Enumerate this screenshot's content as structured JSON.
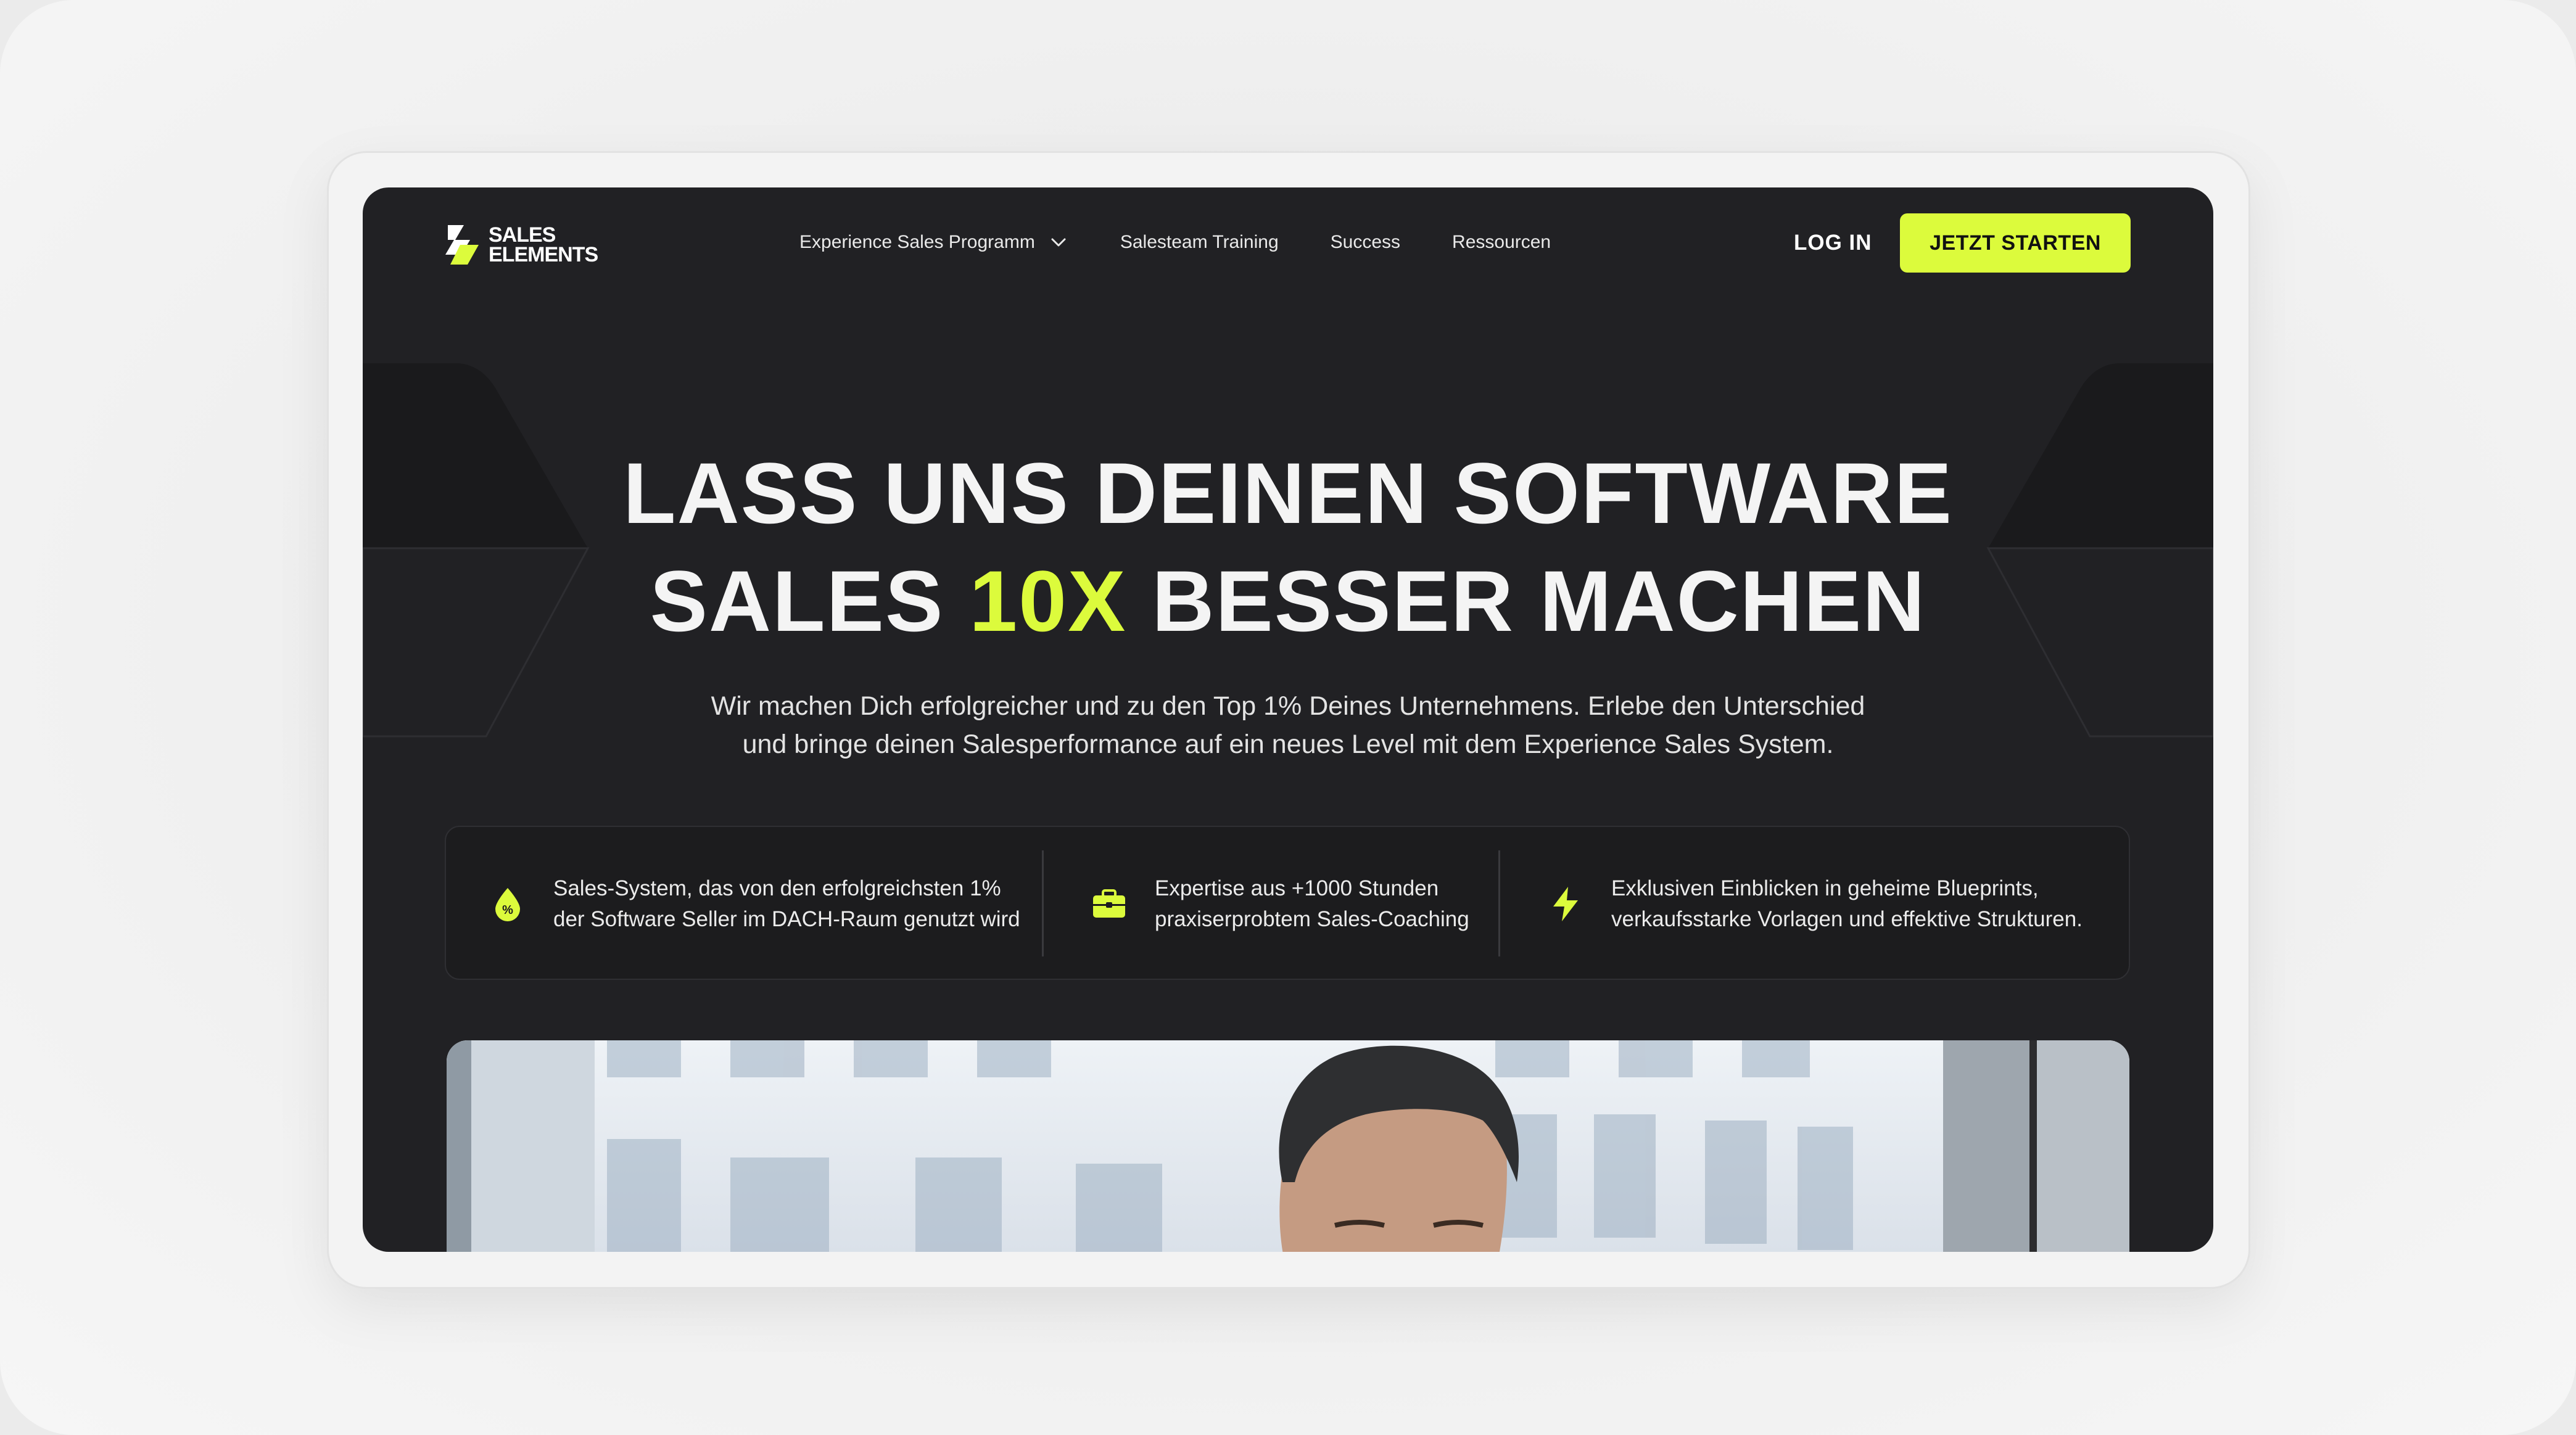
{
  "brand": {
    "line1": "SALES",
    "line2": "ELEMENTS",
    "accent_color": "#dcfb3c"
  },
  "nav": {
    "items": [
      {
        "label": "Experience Sales Programm",
        "has_dropdown": true
      },
      {
        "label": "Salesteam Training"
      },
      {
        "label": "Success"
      },
      {
        "label": "Ressourcen"
      }
    ],
    "login": "LOG IN",
    "cta": "JETZT STARTEN"
  },
  "hero": {
    "line1": "LASS UNS DEINEN SOFTWARE",
    "line2_pre": "SALES",
    "line2_accent": "10X",
    "line2_post": "BESSER MACHEN",
    "sub1": "Wir machen Dich erfolgreicher und zu den Top 1% Deines Unternehmens. Erlebe den Unterschied",
    "sub2": "und bringe deinen Salesperformance auf ein neues Level mit dem Experience Sales System."
  },
  "features": [
    {
      "icon": "percent-drop-icon",
      "line1": "Sales-System, das von den erfolgreichsten 1%",
      "line2": "der Software Seller im DACH-Raum genutzt wird"
    },
    {
      "icon": "briefcase-icon",
      "line1": "Expertise aus +1000 Stunden",
      "line2": "praxiserprobtem Sales-Coaching"
    },
    {
      "icon": "lightning-icon",
      "line1": "Exklusiven Einblicken in geheime Blueprints,",
      "line2": "verkaufsstarke Vorlagen und effektive Strukturen."
    }
  ],
  "colors": {
    "background": "#212124",
    "panel": "#1c1c1e",
    "accent": "#dcfb3c",
    "text": "#f4f4f4"
  }
}
